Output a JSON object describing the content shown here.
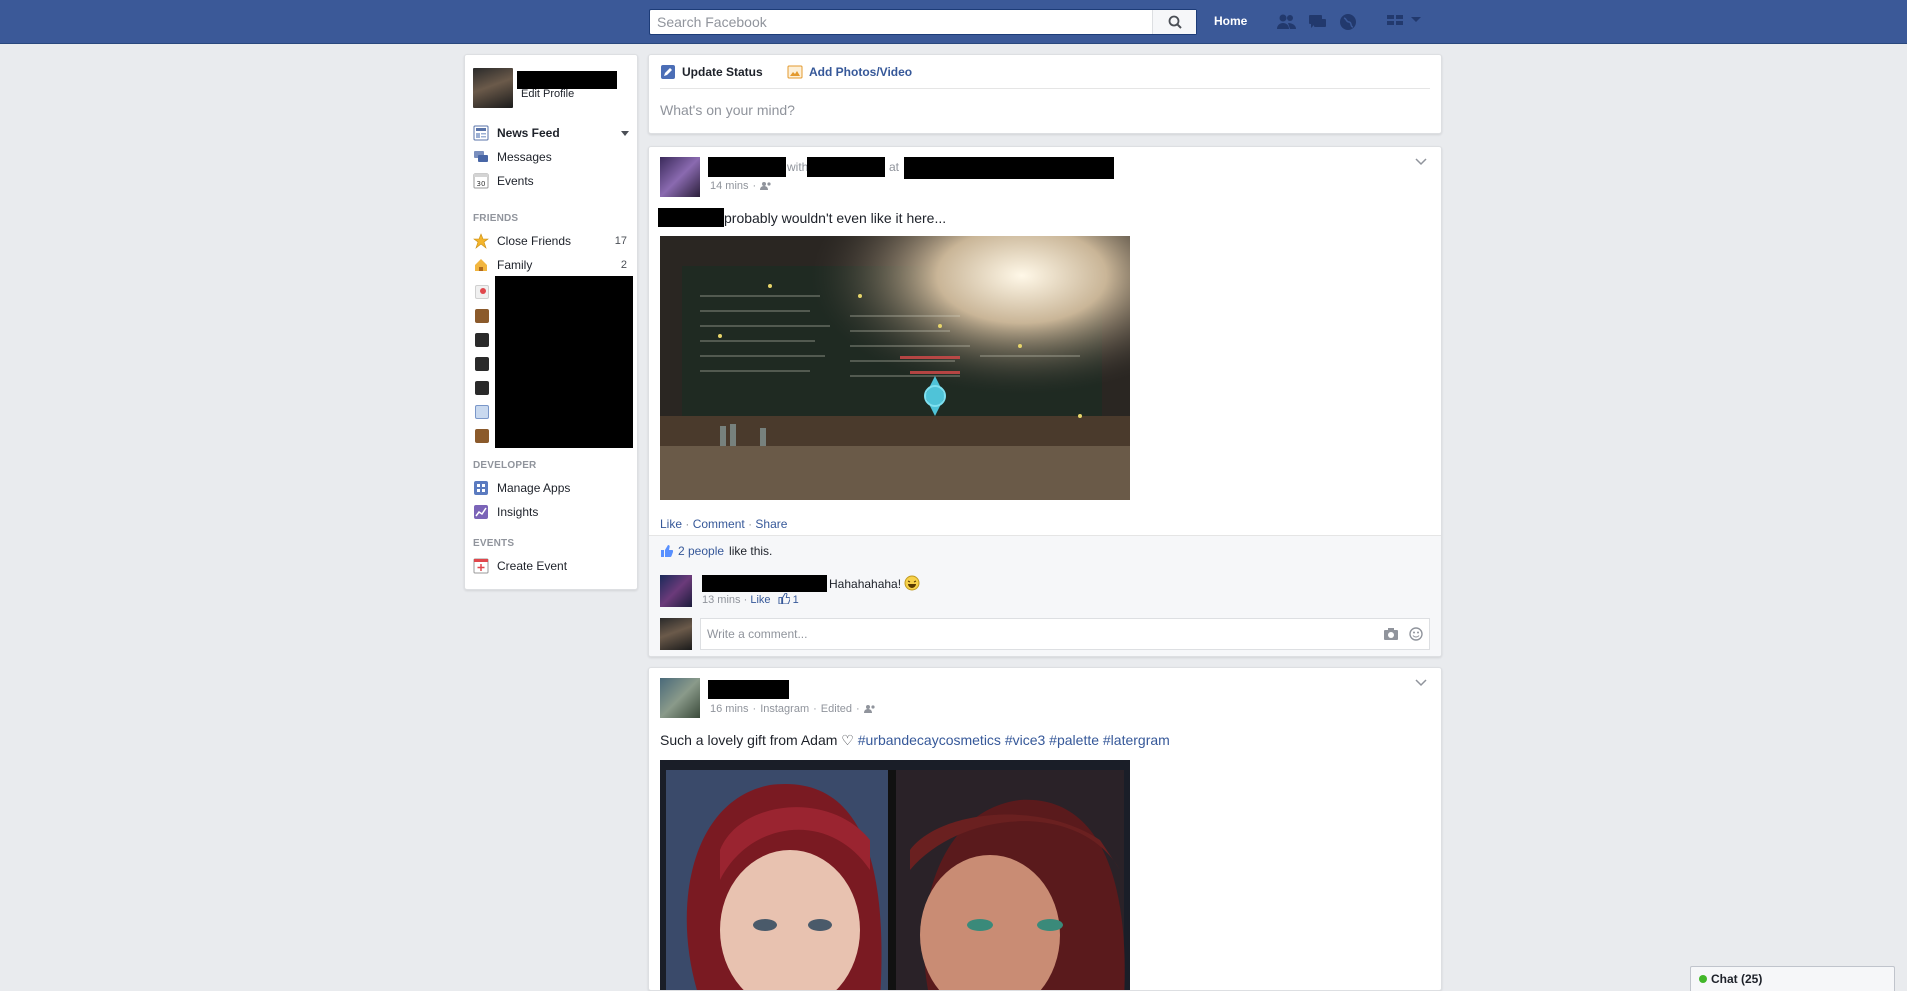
{
  "header": {
    "search_placeholder": "Search Facebook",
    "home_label": "Home",
    "brand_color": "#3b5998"
  },
  "sidebar": {
    "edit_profile": "Edit Profile",
    "nav": [
      {
        "label": "News Feed",
        "icon": "news-feed-icon"
      },
      {
        "label": "Messages",
        "icon": "messages-icon"
      },
      {
        "label": "Events",
        "icon": "events-icon",
        "badge": "30"
      }
    ],
    "friends_header": "FRIENDS",
    "friends": [
      {
        "label": "Close Friends",
        "count": "17",
        "icon": "star-icon"
      },
      {
        "label": "Family",
        "count": "2",
        "icon": "house-icon"
      }
    ],
    "developer_header": "DEVELOPER",
    "developer": [
      {
        "label": "Manage Apps",
        "icon": "apps-icon"
      },
      {
        "label": "Insights",
        "icon": "insights-icon"
      }
    ],
    "events_header": "EVENTS",
    "events": [
      {
        "label": "Create Event",
        "icon": "calendar-plus-icon"
      }
    ]
  },
  "composer": {
    "update_status": "Update Status",
    "add_photos": "Add Photos/Video",
    "placeholder": "What's on your mind?"
  },
  "post1": {
    "with_text": "with",
    "at_text": "at",
    "time": "14 mins",
    "dot": "·",
    "text": "probably wouldn't even like it here...",
    "like": "Like",
    "comment": "Comment",
    "share": "Share",
    "likes_count": "2 people",
    "likes_suffix": "like this.",
    "comment_text": "Hahahahaha!",
    "comment_time": "13 mins",
    "comment_like": "Like",
    "comment_like_count": "1",
    "write_comment": "Write a comment..."
  },
  "post2": {
    "time": "16 mins",
    "source": "Instagram",
    "edited": "Edited",
    "dot": "·",
    "text_plain": "Such a lovely gift from Adam ♡",
    "hashtags": "#urbandecaycosmetics #vice3 #palette #latergram"
  },
  "chat": {
    "label": "Chat (25)"
  }
}
